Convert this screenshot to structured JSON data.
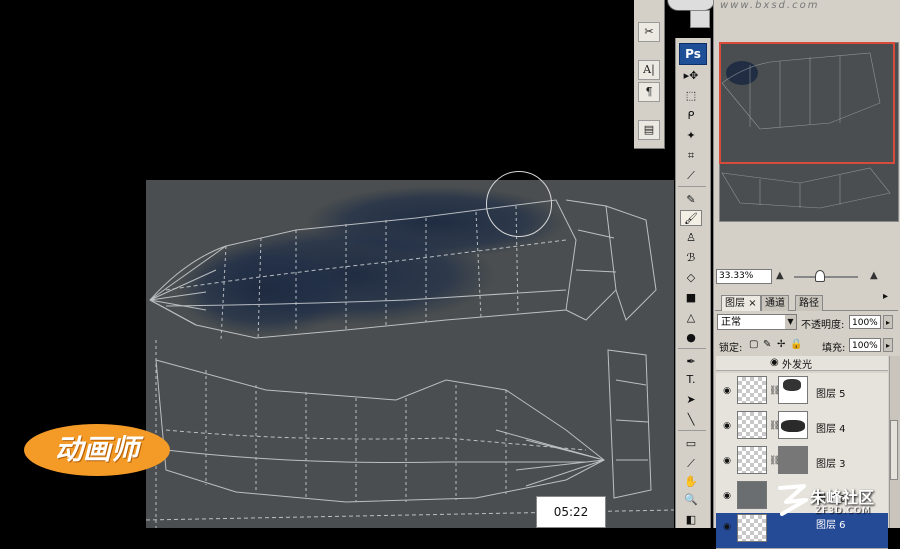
{
  "website": "www.bxsd.com",
  "app_logo": "Ps",
  "floating_strip": {
    "icons": [
      "tools-icon",
      "character-icon",
      "paragraph-icon",
      "layer-comps-icon"
    ],
    "labels": [
      "A|",
      "¶"
    ]
  },
  "toolbox": {
    "icons": [
      "move-tool-icon",
      "marquee-tool-icon",
      "lasso-tool-icon",
      "magic-wand-tool-icon",
      "crop-tool-icon",
      "slice-tool-icon",
      "healing-brush-tool-icon",
      "brush-tool-icon",
      "clone-stamp-tool-icon",
      "history-brush-tool-icon",
      "eraser-tool-icon",
      "gradient-tool-icon",
      "blur-tool-icon",
      "dodge-tool-icon",
      "pen-tool-icon",
      "type-tool-icon",
      "path-selection-tool-icon",
      "line-tool-icon",
      "notes-tool-icon",
      "eyedropper-tool-icon",
      "hand-tool-icon",
      "zoom-tool-icon",
      "colors-icon"
    ],
    "type_glyph": "T."
  },
  "navigator": {
    "zoom": "33.33%"
  },
  "layers_panel": {
    "tabs": [
      "图层",
      "通道",
      "路径"
    ],
    "tab_close": "×",
    "blend_mode": "正常",
    "opacity_label": "不透明度:",
    "opacity_value": "100%",
    "lock_label": "锁定:",
    "fill_label": "填充:",
    "fill_value": "100%",
    "effect_label": "外发光",
    "layers": [
      {
        "name": "图层 5"
      },
      {
        "name": "图层 4"
      },
      {
        "name": "图层 3"
      },
      {
        "name": "图层 2"
      },
      {
        "name": "图层 6"
      }
    ]
  },
  "brand_logo": "动画师",
  "watermark": {
    "name": "朱峰社区",
    "url": "ZF3D.COM"
  },
  "timestamp": "05:22",
  "colors": {
    "canvas_bg": "#4a4e50",
    "panel_bg": "#d4d0c8",
    "navigator_highlight": "#d84a3a",
    "selected_layer": "#254a96",
    "brand_orange": "#f39a27",
    "ps_blue": "#1f4f96"
  }
}
